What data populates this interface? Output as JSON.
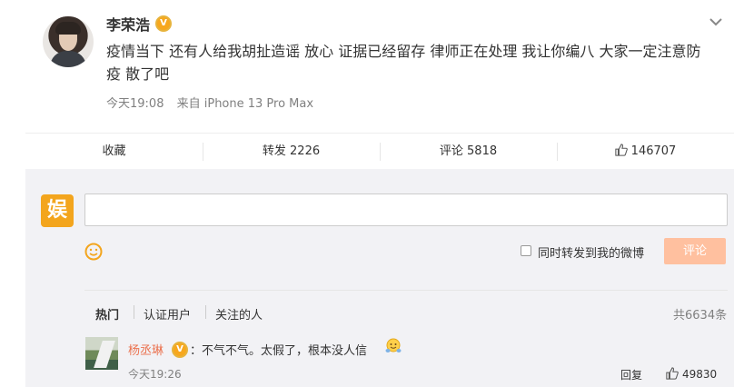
{
  "post": {
    "username": "李荣浩",
    "text": "疫情当下 还有人给我胡扯造谣 放心 证据已经留存 律师正在处理 我让你编八 大家一定注意防疫 散了吧",
    "time": "今天19:08",
    "source": "来自 iPhone 13 Pro Max"
  },
  "actions": {
    "collect": "收藏",
    "forward": "转发 2226",
    "comment": "评论 5818",
    "like": "146707"
  },
  "composer": {
    "placeholder": "",
    "sync_label": "同时转发到我的微博",
    "submit_label": "评论"
  },
  "comment_tabs": {
    "hot": "热门",
    "verified": "认证用户",
    "following": "关注的人",
    "total": "共6634条"
  },
  "comments": [
    {
      "username": "杨丞琳",
      "text": "：不气不气。太假了，根本没人信",
      "time": "今天19:26",
      "reply_label": "回复",
      "likes": "49830"
    }
  ],
  "colors": {
    "accent_orange": "#eb7350",
    "badge_gold": "#f7a71d",
    "submit_disabled": "#ffc09f"
  }
}
